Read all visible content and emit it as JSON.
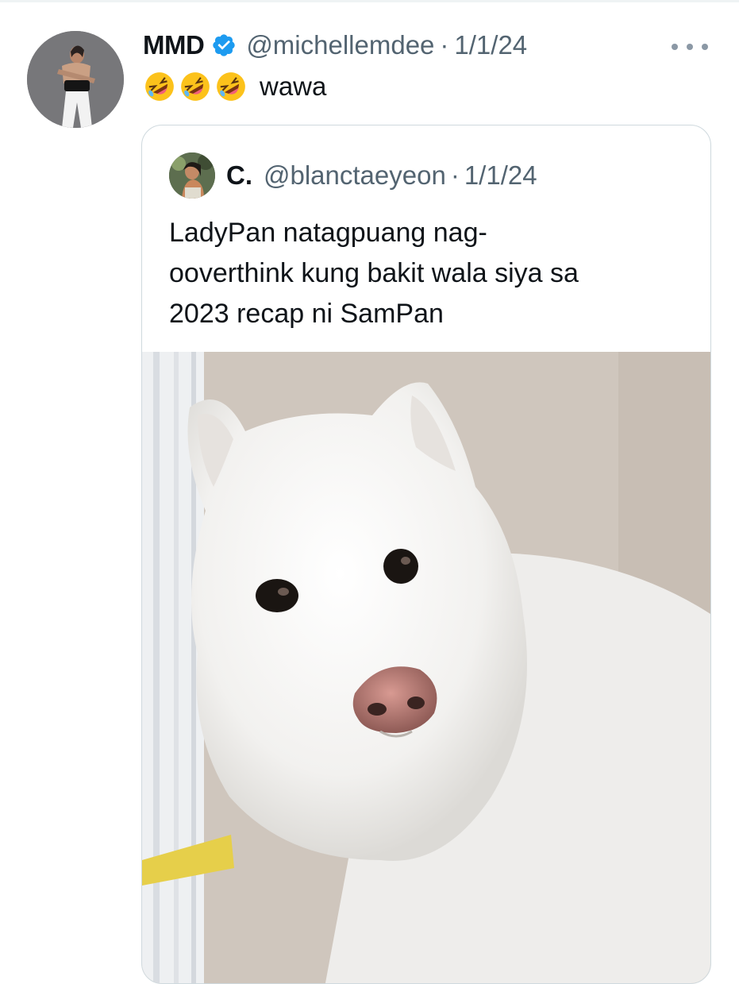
{
  "tweet": {
    "display_name": "MMD",
    "verified": true,
    "handle": "@michellemdee",
    "separator": "·",
    "date": "1/1/24",
    "avatar_icon": "profile-photo-woman",
    "emojis": [
      "rolling-on-floor-laughing-emoji",
      "rolling-on-floor-laughing-emoji",
      "rolling-on-floor-laughing-emoji"
    ],
    "text": "wawa",
    "more_icon": "more-horizontal-icon"
  },
  "quoted_tweet": {
    "display_name": "C.",
    "handle": "@blanctaeyeon",
    "separator": "·",
    "date": "1/1/24",
    "avatar_icon": "profile-photo-woman-garden",
    "text_lines": [
      "LadyPan natagpuang nag-",
      "ooverthink kung bakit wala siya sa",
      "2023 recap ni SamPan"
    ],
    "media": "photo-white-samoyed-dog"
  },
  "colors": {
    "text": "#0f1419",
    "secondary": "#536471",
    "verified": "#1d9bf0",
    "border": "#cfd9de"
  }
}
